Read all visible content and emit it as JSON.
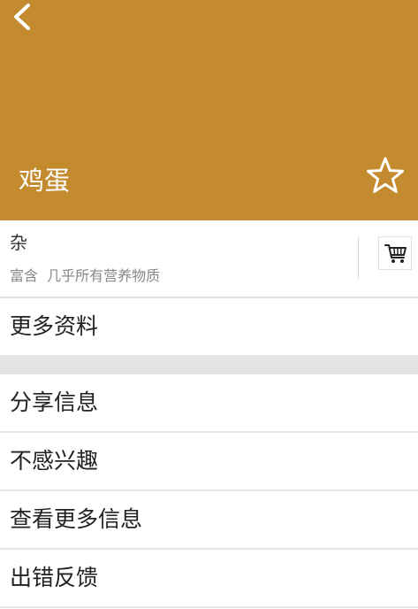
{
  "header": {
    "title": "鸡蛋",
    "background_color": "#c38a2e",
    "back_icon": "back-arrow-icon",
    "favorite_icon": "star-outline-icon"
  },
  "info": {
    "category": "杂",
    "description": "富含  几乎所有营养物质",
    "cart_icon": "shopping-cart-icon"
  },
  "more_info": {
    "label": "更多资料"
  },
  "menu": {
    "items": [
      {
        "label": "分享信息"
      },
      {
        "label": "不感兴趣"
      },
      {
        "label": "查看更多信息"
      },
      {
        "label": "出错反馈"
      }
    ]
  }
}
